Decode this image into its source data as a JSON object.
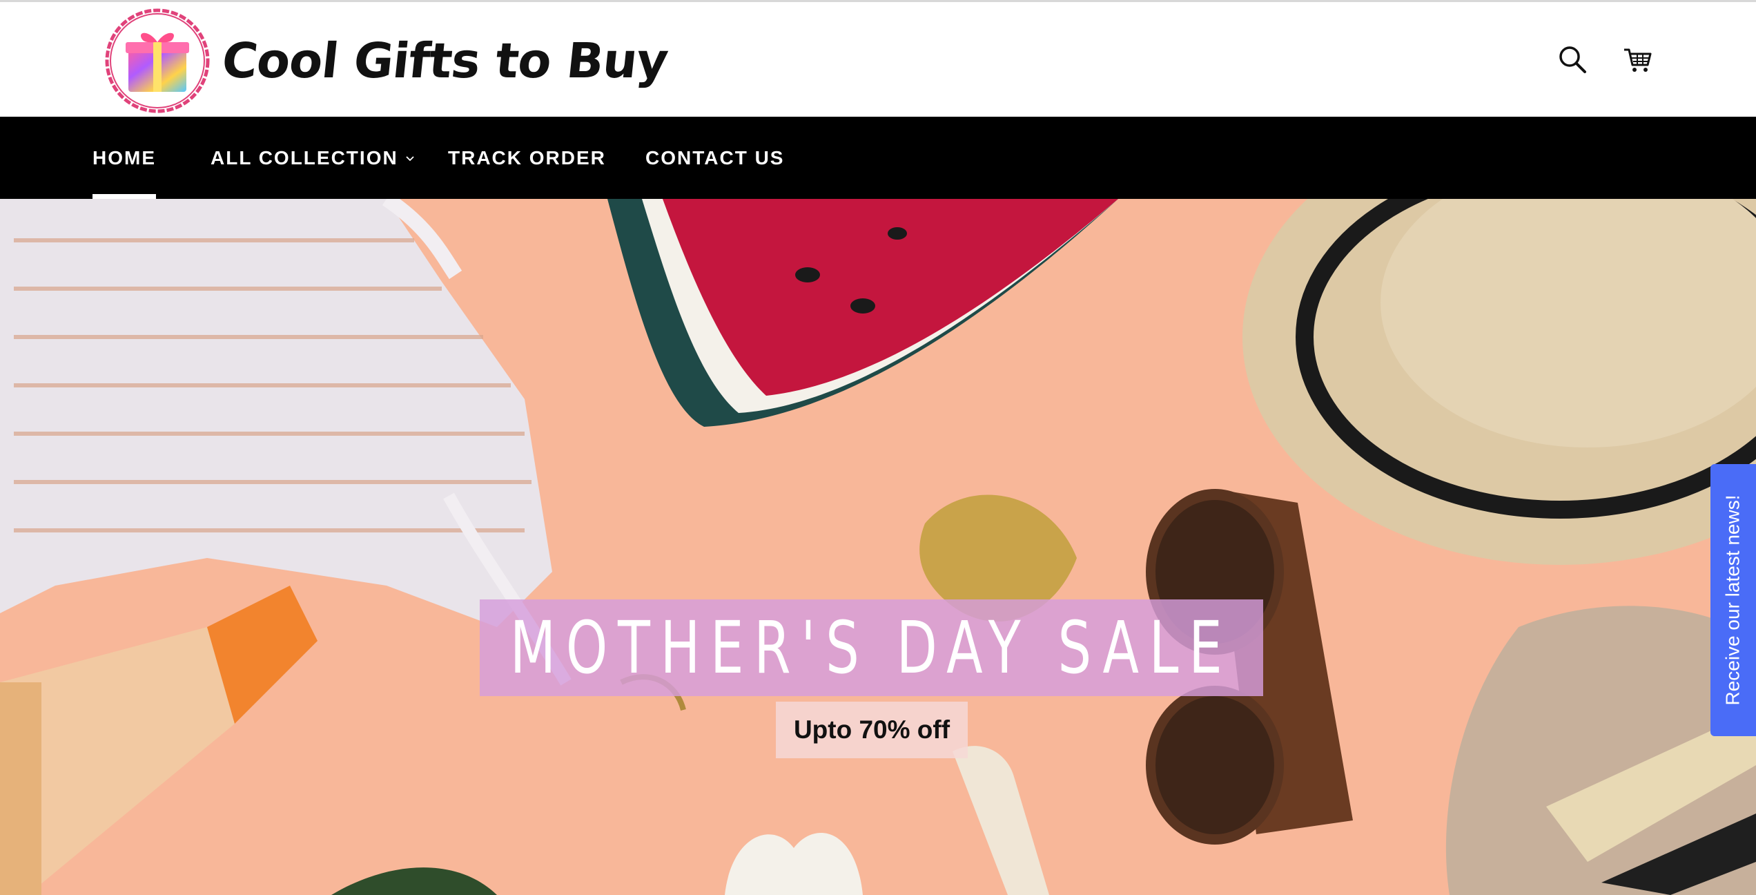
{
  "header": {
    "logo_text": "Cool Gifts to Buy",
    "logo_icon": "gift-icon",
    "search_icon": "search-icon",
    "cart_icon": "cart-icon"
  },
  "nav": {
    "items": [
      {
        "label": "HOME",
        "active": true
      },
      {
        "label": "ALL COLLECTION",
        "has_dropdown": true
      },
      {
        "label": "TRACK ORDER"
      },
      {
        "label": "CONTACT US"
      }
    ]
  },
  "hero": {
    "title": "MOTHER'S DAY SALE",
    "subtitle": "Upto 70% off"
  },
  "newsletter_tab": {
    "label": "Receive our latest news!",
    "color": "#4a6cf7"
  },
  "colors": {
    "nav_bg": "#000000",
    "hero_bg": "#f8b799",
    "title_box": "#d69edc",
    "logo_ring": "#e0427a"
  }
}
